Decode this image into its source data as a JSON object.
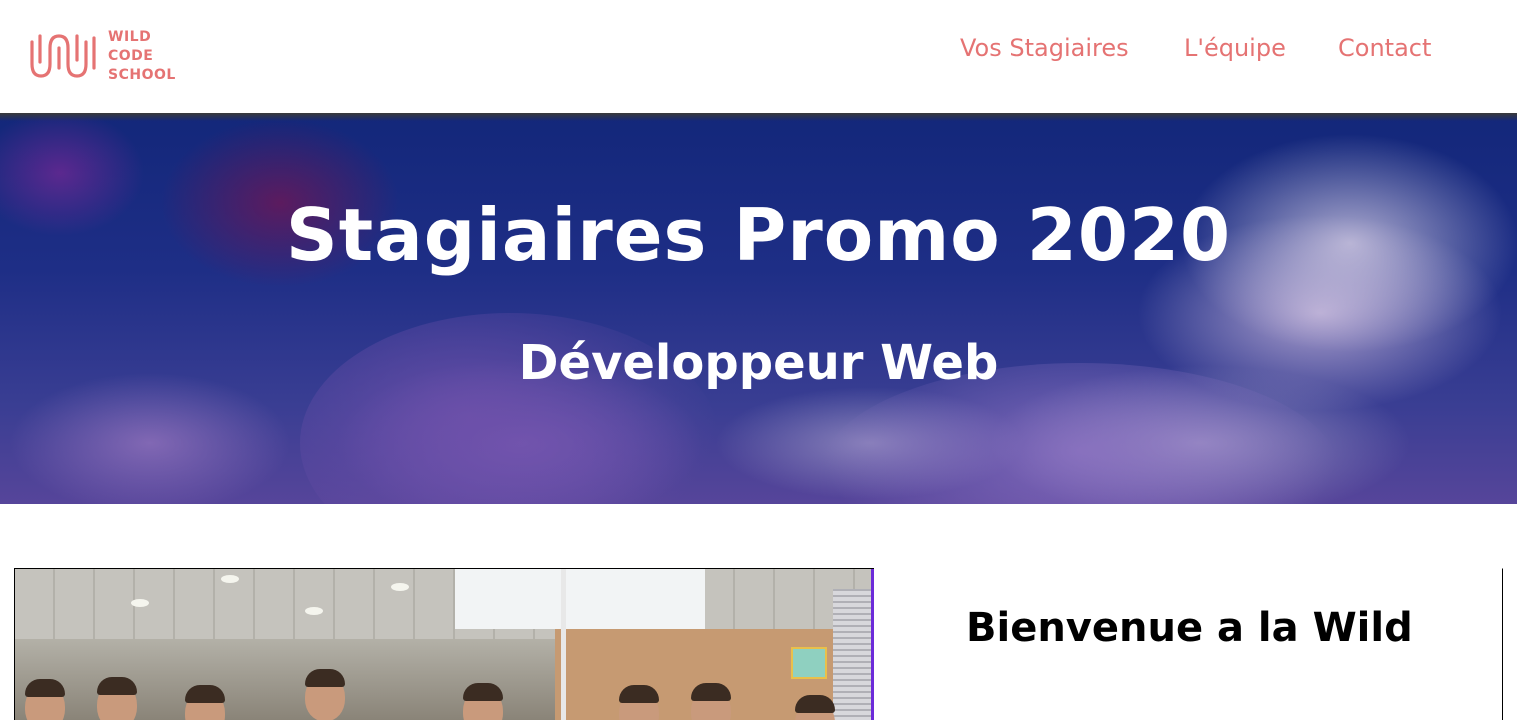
{
  "brand": {
    "logo_lines": [
      "WILD",
      "CODE",
      "SCHOOL"
    ],
    "color": "#e57373"
  },
  "nav": {
    "items": [
      "Vos Stagiaires",
      "L'équipe",
      "Contact"
    ]
  },
  "hero": {
    "title": "Stagiaires Promo 2020",
    "subtitle": "Développeur Web"
  },
  "main": {
    "photo_icon": "team-photo",
    "welcome_title": "Bienvenue a la Wild"
  }
}
